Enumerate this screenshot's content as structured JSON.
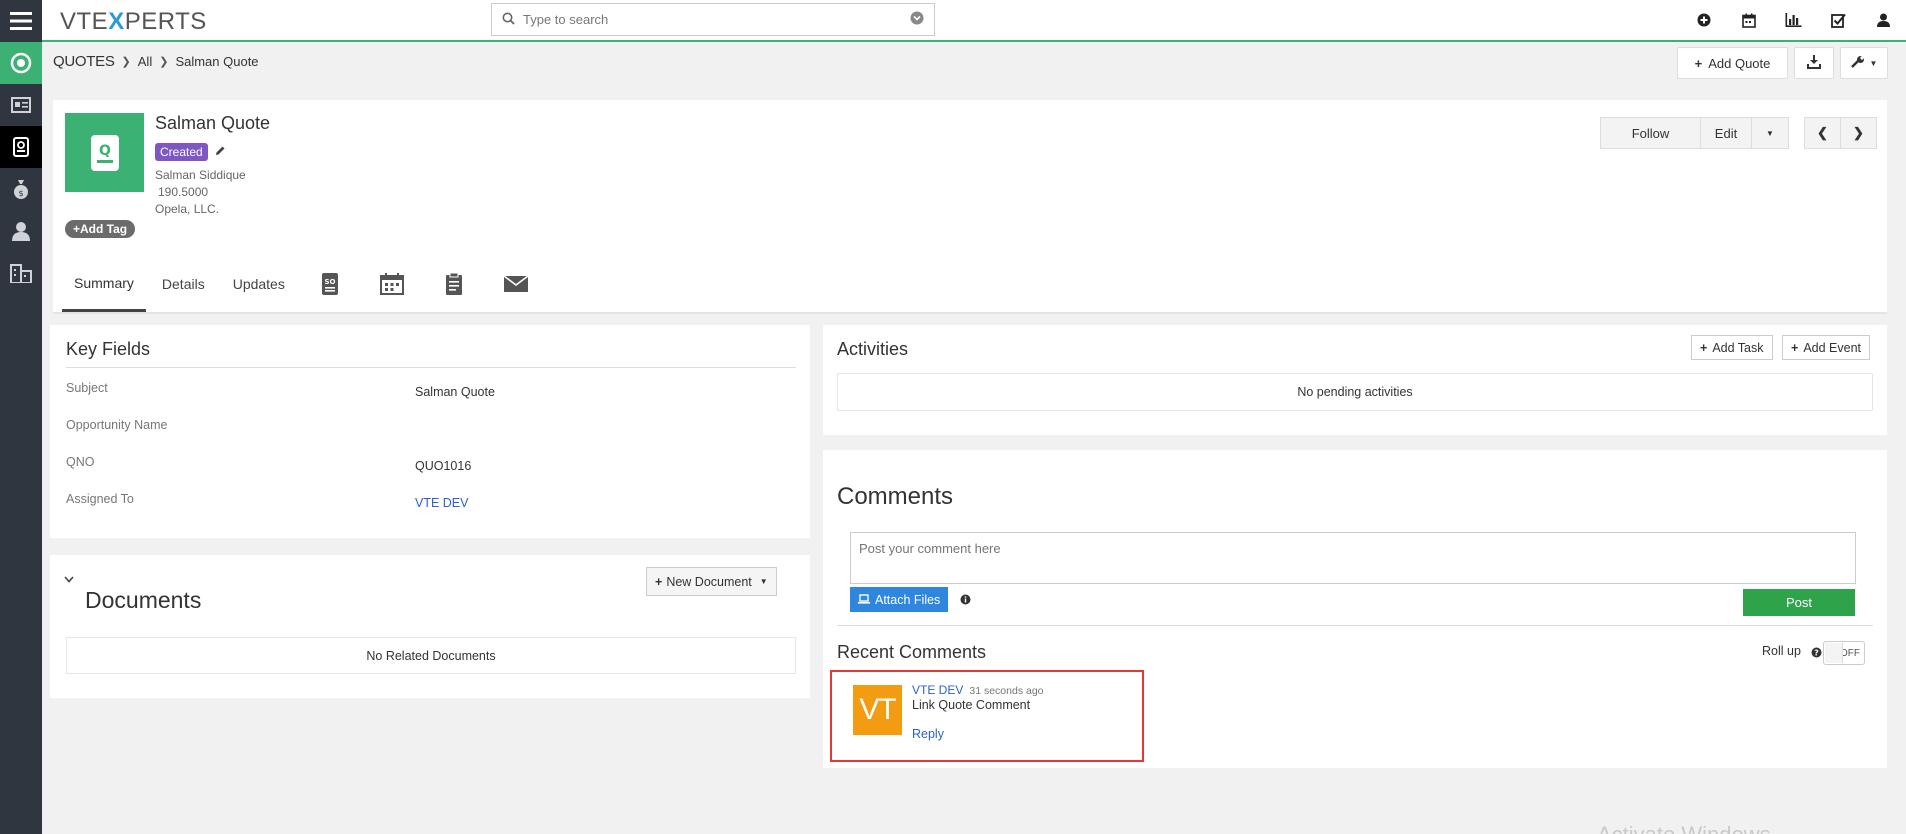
{
  "app": {
    "logo": {
      "vte": "VTE",
      "x": "X",
      "perts": "PERTS"
    }
  },
  "search": {
    "placeholder": "Type to search"
  },
  "breadcrumb": {
    "module": "QUOTES",
    "all": "All",
    "record": "Salman Quote"
  },
  "header_actions": {
    "add_quote": "Add Quote"
  },
  "record": {
    "title": "Salman Quote",
    "status": "Created",
    "contact": "Salman Siddique",
    "amount": "190.5000",
    "organization": "Opela, LLC.",
    "add_tag": "Add Tag"
  },
  "record_actions": {
    "follow": "Follow",
    "edit": "Edit"
  },
  "tabs": [
    {
      "label": "Summary",
      "active": true
    },
    {
      "label": "Details"
    },
    {
      "label": "Updates"
    }
  ],
  "tab_icons": [
    "sales-order-icon",
    "calendar-icon",
    "document-icon",
    "email-icon"
  ],
  "key_fields": {
    "title": "Key Fields",
    "rows": [
      {
        "label": "Subject",
        "value": "Salman Quote"
      },
      {
        "label": "Opportunity Name",
        "value": ""
      },
      {
        "label": "QNO",
        "value": "QUO1016"
      },
      {
        "label": "Assigned To",
        "value": "VTE DEV"
      }
    ]
  },
  "documents": {
    "title": "Documents",
    "new_button": "New Document",
    "empty": "No Related Documents"
  },
  "activities": {
    "title": "Activities",
    "add_task": "Add Task",
    "add_event": "Add Event",
    "empty": "No pending activities"
  },
  "comments": {
    "title": "Comments",
    "placeholder": "Post your comment here",
    "attach": "Attach Files",
    "post": "Post",
    "recent_title": "Recent Comments",
    "rollup_label": "Roll up",
    "rollup_state": "OFF",
    "items": [
      {
        "avatar": "VT",
        "author": "VTE DEV",
        "time": "31 seconds ago",
        "text": "Link Quote Comment",
        "reply": "Reply"
      }
    ]
  },
  "watermark": "Activate Windows",
  "colors": {
    "accent": "#3bb273",
    "sidebar": "#2f3640",
    "badge": "#7e57c2",
    "link": "#2c62d4",
    "highlight": "#e53935",
    "avatar": "#f39c12"
  }
}
